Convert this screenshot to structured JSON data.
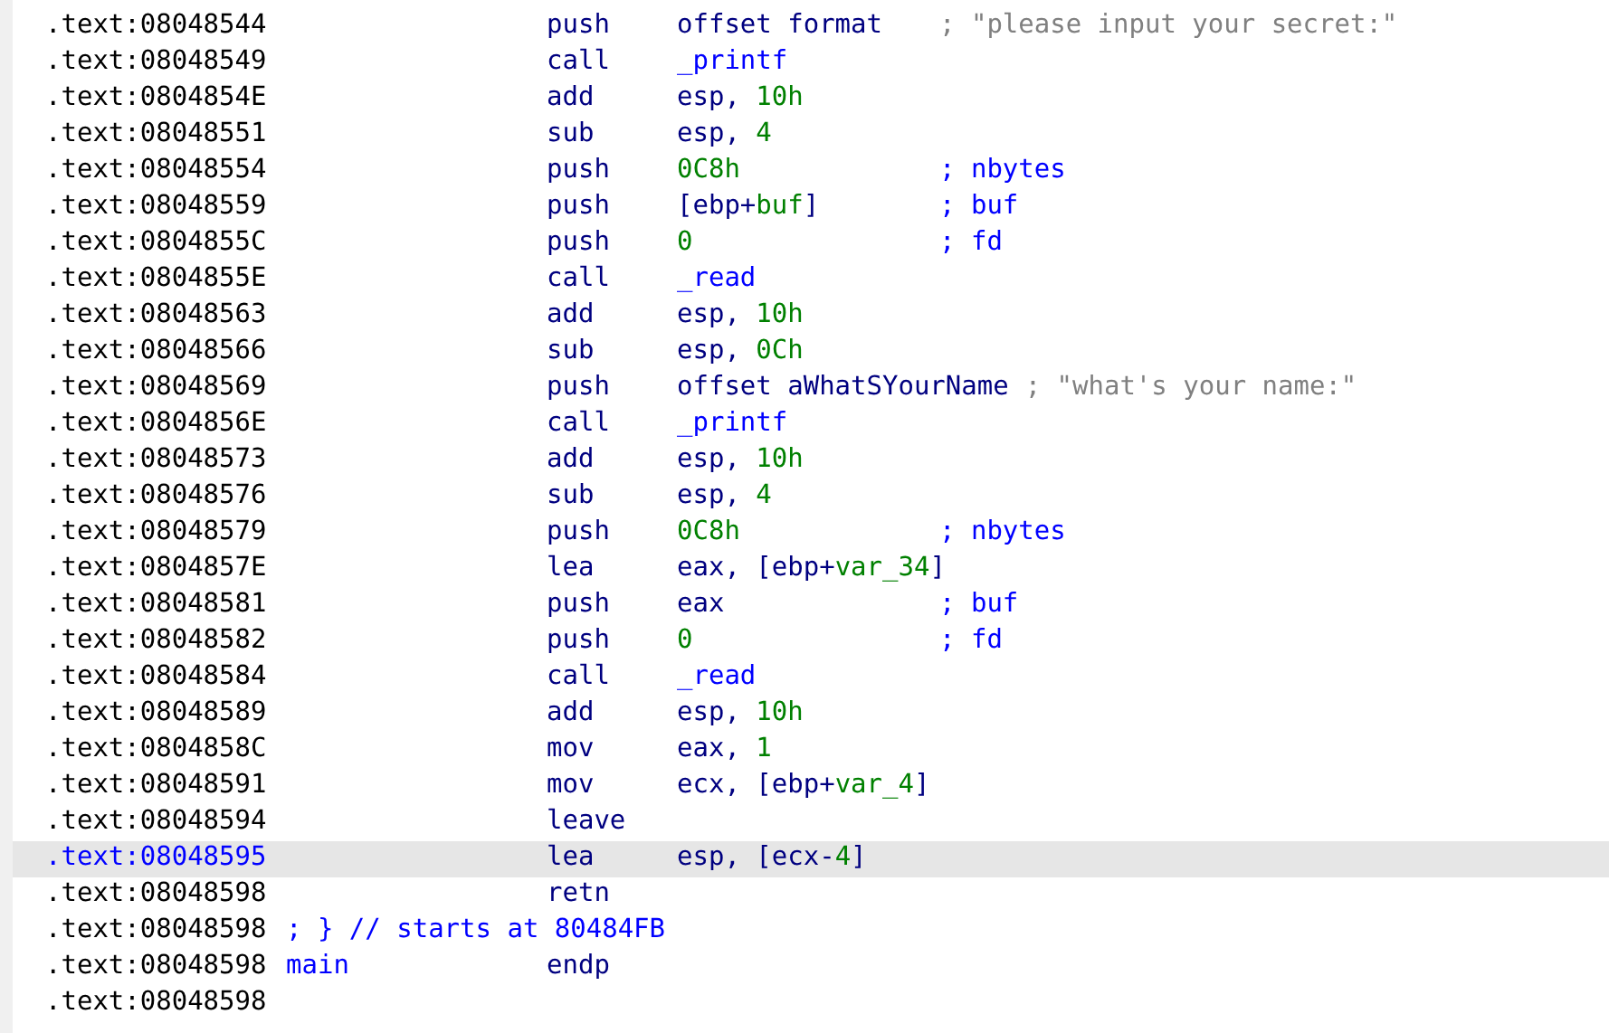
{
  "lines": [
    {
      "address": ".text:08048544",
      "mnemonic": "push",
      "operands": [
        {
          "text": "offset format",
          "kind": "plain"
        }
      ],
      "comment": {
        "text": "; \"please input your secret:\"",
        "kind": "string"
      },
      "selected": false
    },
    {
      "address": ".text:08048549",
      "mnemonic": "call",
      "operands": [
        {
          "text": "_printf",
          "kind": "name"
        }
      ],
      "selected": false
    },
    {
      "address": ".text:0804854E",
      "mnemonic": "add",
      "operands": [
        {
          "text": "esp, ",
          "kind": "plain"
        },
        {
          "text": "10h",
          "kind": "num"
        }
      ],
      "selected": false
    },
    {
      "address": ".text:08048551",
      "mnemonic": "sub",
      "operands": [
        {
          "text": "esp, ",
          "kind": "plain"
        },
        {
          "text": "4",
          "kind": "num"
        }
      ],
      "selected": false
    },
    {
      "address": ".text:08048554",
      "mnemonic": "push",
      "operands": [
        {
          "text": "0C8h",
          "kind": "num"
        }
      ],
      "comment": {
        "text": "; nbytes",
        "kind": "name"
      },
      "selected": false
    },
    {
      "address": ".text:08048559",
      "mnemonic": "push",
      "operands": [
        {
          "text": "[ebp+",
          "kind": "plain"
        },
        {
          "text": "buf",
          "kind": "num"
        },
        {
          "text": "]",
          "kind": "plain"
        }
      ],
      "comment": {
        "text": "; buf",
        "kind": "name"
      },
      "selected": false
    },
    {
      "address": ".text:0804855C",
      "mnemonic": "push",
      "operands": [
        {
          "text": "0",
          "kind": "num"
        }
      ],
      "comment": {
        "text": "; fd",
        "kind": "name"
      },
      "selected": false
    },
    {
      "address": ".text:0804855E",
      "mnemonic": "call",
      "operands": [
        {
          "text": "_read",
          "kind": "name"
        }
      ],
      "selected": false
    },
    {
      "address": ".text:08048563",
      "mnemonic": "add",
      "operands": [
        {
          "text": "esp, ",
          "kind": "plain"
        },
        {
          "text": "10h",
          "kind": "num"
        }
      ],
      "selected": false
    },
    {
      "address": ".text:08048566",
      "mnemonic": "sub",
      "operands": [
        {
          "text": "esp, ",
          "kind": "plain"
        },
        {
          "text": "0Ch",
          "kind": "num"
        }
      ],
      "selected": false
    },
    {
      "address": ".text:08048569",
      "mnemonic": "push",
      "operands": [
        {
          "text": "offset aWhatSYourName",
          "kind": "plain"
        }
      ],
      "comment": {
        "text": "; \"what's your name:\"",
        "kind": "string"
      },
      "selected": false
    },
    {
      "address": ".text:0804856E",
      "mnemonic": "call",
      "operands": [
        {
          "text": "_printf",
          "kind": "name"
        }
      ],
      "selected": false
    },
    {
      "address": ".text:08048573",
      "mnemonic": "add",
      "operands": [
        {
          "text": "esp, ",
          "kind": "plain"
        },
        {
          "text": "10h",
          "kind": "num"
        }
      ],
      "selected": false
    },
    {
      "address": ".text:08048576",
      "mnemonic": "sub",
      "operands": [
        {
          "text": "esp, ",
          "kind": "plain"
        },
        {
          "text": "4",
          "kind": "num"
        }
      ],
      "selected": false
    },
    {
      "address": ".text:08048579",
      "mnemonic": "push",
      "operands": [
        {
          "text": "0C8h",
          "kind": "num"
        }
      ],
      "comment": {
        "text": "; nbytes",
        "kind": "name"
      },
      "selected": false
    },
    {
      "address": ".text:0804857E",
      "mnemonic": "lea",
      "operands": [
        {
          "text": "eax, [ebp+",
          "kind": "plain"
        },
        {
          "text": "var_34",
          "kind": "num"
        },
        {
          "text": "]",
          "kind": "plain"
        }
      ],
      "selected": false
    },
    {
      "address": ".text:08048581",
      "mnemonic": "push",
      "operands": [
        {
          "text": "eax",
          "kind": "plain"
        }
      ],
      "comment": {
        "text": "; buf",
        "kind": "name"
      },
      "selected": false
    },
    {
      "address": ".text:08048582",
      "mnemonic": "push",
      "operands": [
        {
          "text": "0",
          "kind": "num"
        }
      ],
      "comment": {
        "text": "; fd",
        "kind": "name"
      },
      "selected": false
    },
    {
      "address": ".text:08048584",
      "mnemonic": "call",
      "operands": [
        {
          "text": "_read",
          "kind": "name"
        }
      ],
      "selected": false
    },
    {
      "address": ".text:08048589",
      "mnemonic": "add",
      "operands": [
        {
          "text": "esp, ",
          "kind": "plain"
        },
        {
          "text": "10h",
          "kind": "num"
        }
      ],
      "selected": false
    },
    {
      "address": ".text:0804858C",
      "mnemonic": "mov",
      "operands": [
        {
          "text": "eax, ",
          "kind": "plain"
        },
        {
          "text": "1",
          "kind": "num"
        }
      ],
      "selected": false
    },
    {
      "address": ".text:08048591",
      "mnemonic": "mov",
      "operands": [
        {
          "text": "ecx, [ebp+",
          "kind": "plain"
        },
        {
          "text": "var_4",
          "kind": "num"
        },
        {
          "text": "]",
          "kind": "plain"
        }
      ],
      "selected": false
    },
    {
      "address": ".text:08048594",
      "mnemonic": "leave",
      "selected": false
    },
    {
      "address": ".text:08048595",
      "mnemonic": "lea",
      "operands": [
        {
          "text": "esp",
          "kind": "plain"
        },
        {
          "text": ", [ecx-",
          "kind": "plain"
        },
        {
          "text": "4",
          "kind": "num"
        },
        {
          "text": "]",
          "kind": "plain"
        }
      ],
      "selected": true
    },
    {
      "address": ".text:08048598",
      "mnemonic": "retn",
      "selected": false
    },
    {
      "address": ".text:08048598",
      "label": "; } // starts at 80484FB",
      "selected": false
    },
    {
      "address": ".text:08048598",
      "label": "main",
      "mnemonic": "endp",
      "selected": false
    },
    {
      "address": ".text:08048598",
      "selected": false
    }
  ]
}
